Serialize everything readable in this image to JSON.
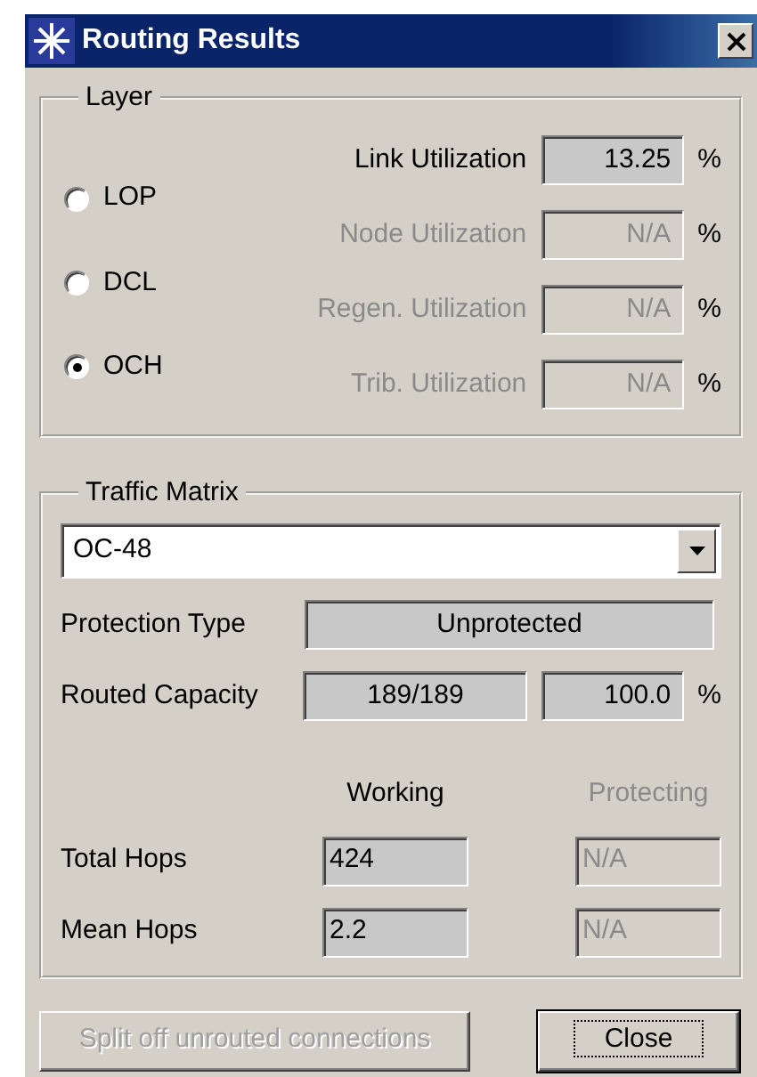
{
  "window": {
    "title": "Routing Results"
  },
  "layer": {
    "label": "Layer",
    "options": [
      {
        "label": "LOP",
        "selected": false
      },
      {
        "label": "DCL",
        "selected": false
      },
      {
        "label": "OCH",
        "selected": true
      }
    ],
    "metrics": [
      {
        "label": "Link Utilization",
        "value": "13.25",
        "unit": "%",
        "disabled": false
      },
      {
        "label": "Node Utilization",
        "value": "N/A",
        "unit": "%",
        "disabled": true
      },
      {
        "label": "Regen. Utilization",
        "value": "N/A",
        "unit": "%",
        "disabled": true
      },
      {
        "label": "Trib. Utilization",
        "value": "N/A",
        "unit": "%",
        "disabled": true
      }
    ]
  },
  "traffic": {
    "label": "Traffic Matrix",
    "matrix": {
      "value": "OC-48"
    },
    "protection_type": {
      "label": "Protection Type",
      "value": "Unprotected"
    },
    "routed_capacity": {
      "label": "Routed Capacity",
      "value": "189/189",
      "percent": "100.0",
      "unit": "%"
    },
    "columns": [
      {
        "label": "Working",
        "disabled": false
      },
      {
        "label": "Protecting",
        "disabled": true
      }
    ],
    "rows": [
      {
        "label": "Total Hops",
        "values": [
          "424",
          "N/A"
        ]
      },
      {
        "label": "Mean Hops",
        "values": [
          "2.2",
          "N/A"
        ]
      }
    ]
  },
  "buttons": [
    {
      "label": "Split off unrouted connections",
      "disabled": true,
      "focused": false
    },
    {
      "label": "Close",
      "disabled": false,
      "focused": true
    }
  ]
}
